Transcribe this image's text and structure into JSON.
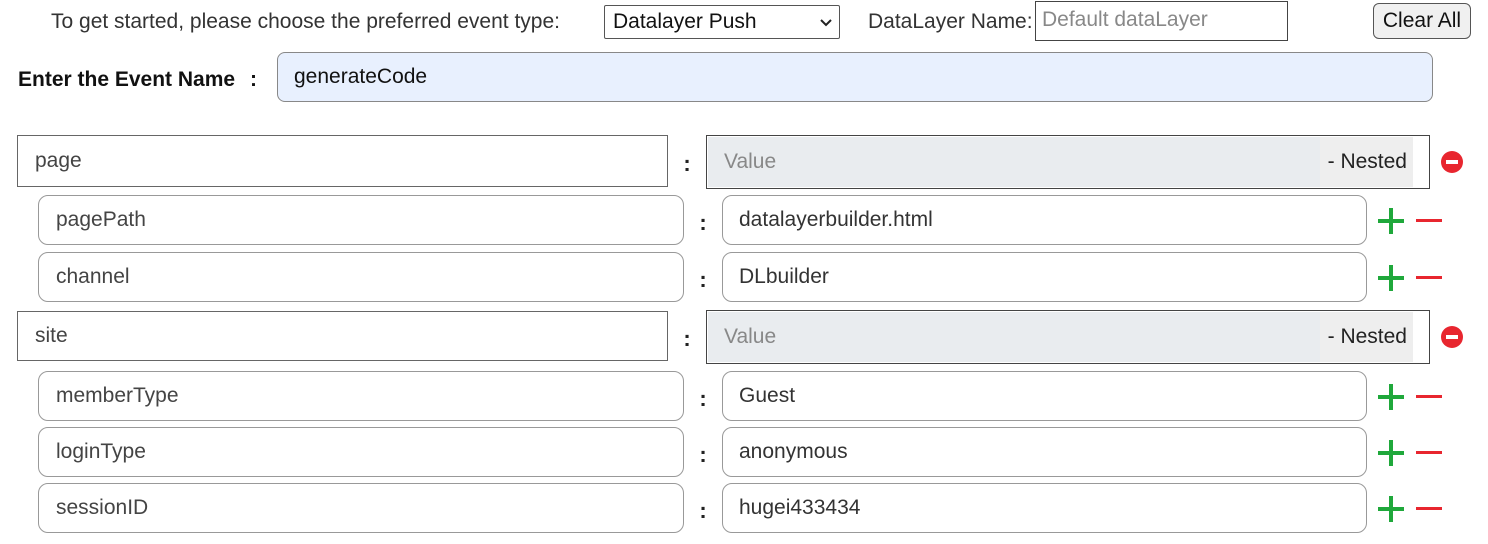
{
  "header": {
    "intro_text": "To get started, please choose the preferred event type:",
    "event_type_selected": "Datalayer Push",
    "datalayer_name_label": "DataLayer Name:",
    "datalayer_name_placeholder": "Default dataLayer",
    "clear_all_label": "Clear All"
  },
  "event": {
    "label": "Enter the Event Name",
    "colon": ":",
    "value": "generateCode"
  },
  "separator": ":",
  "nested_suffix": "- Nested",
  "value_placeholder": "Value",
  "groups": [
    {
      "key": "page",
      "children": [
        {
          "key": "pagePath",
          "value": "datalayerbuilder.html"
        },
        {
          "key": "channel",
          "value": "DLbuilder"
        }
      ]
    },
    {
      "key": "site",
      "children": [
        {
          "key": "memberType",
          "value": "Guest"
        },
        {
          "key": "loginType",
          "value": "anonymous"
        },
        {
          "key": "sessionID",
          "value": "hugei433434"
        }
      ]
    }
  ],
  "colors": {
    "add": "#1fa83b",
    "remove": "#e8262f",
    "event_input_bg": "#e8f0fe",
    "nested_value_bg": "#e9ecef"
  },
  "icons": {
    "add": "plus-icon",
    "remove": "minus-icon",
    "remove_group": "remove-circle-icon",
    "dropdown": "chevron-down-icon"
  }
}
